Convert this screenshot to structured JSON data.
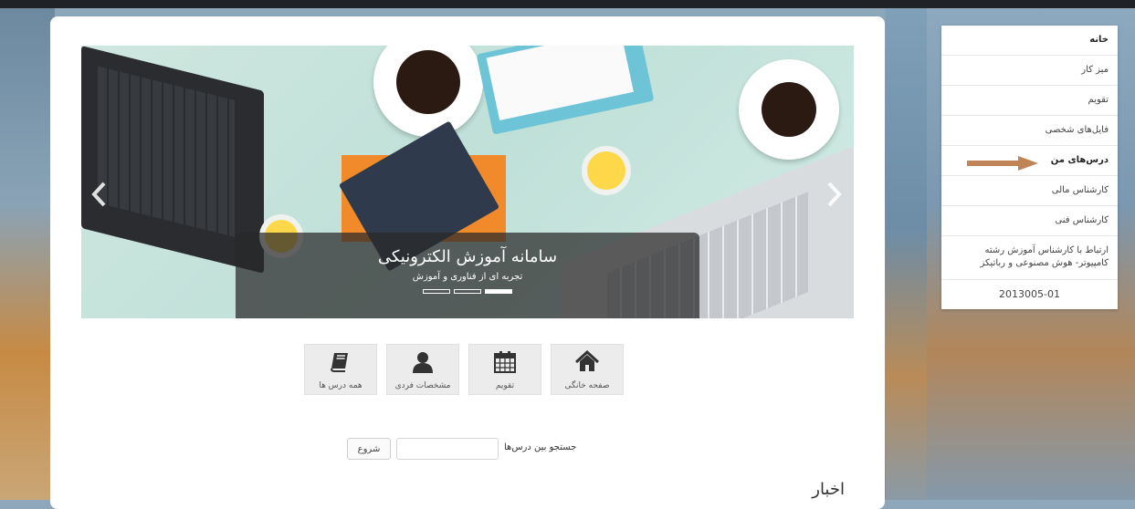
{
  "slider": {
    "title": "سامانه آموزش الکترونیکی",
    "subtitle": "تجربه ای از فناوری و آموزش",
    "prev_icon": "chevron-left-icon",
    "next_icon": "chevron-right-icon",
    "slide_count": 3,
    "active_slide": 3
  },
  "quick_links": [
    {
      "label": "همه درس ها",
      "icon": "book-icon"
    },
    {
      "label": "مشخصات فردی",
      "icon": "user-icon"
    },
    {
      "label": "تقویم",
      "icon": "calendar-icon"
    },
    {
      "label": "صفحه خانگی",
      "icon": "home-icon"
    }
  ],
  "search": {
    "label": "جستجو بین درس‌ها",
    "button_label": "شروع",
    "value": ""
  },
  "news": {
    "heading": "اخبار"
  },
  "sidebar": {
    "items": [
      {
        "label": "خانه"
      },
      {
        "label": "میز کار"
      },
      {
        "label": "تقویم"
      },
      {
        "label": "فایل‌های شخصی"
      },
      {
        "label": "درس‌های من"
      },
      {
        "label": "کارشناس مالی"
      },
      {
        "label": "کارشناس فنی"
      },
      {
        "label": "ارتباط با کارشناس آموزش رشته کامپیوتر- هوش مصنوعی و رباتیکز"
      },
      {
        "label": "2013005-01"
      }
    ],
    "arrow_color": "#c08456"
  },
  "colors": {
    "caption_bg": "#282828",
    "tile_bg": "#ececec",
    "icon_color": "#333333"
  }
}
